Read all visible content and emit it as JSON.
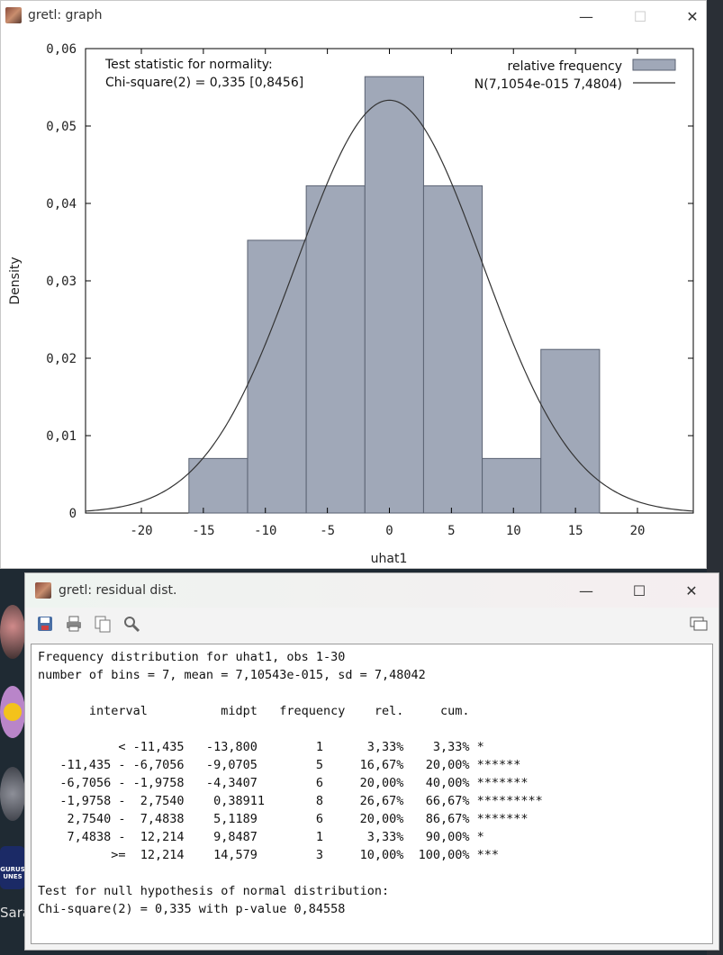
{
  "graph_window": {
    "title": "gretl: graph",
    "controls": {
      "minimize": "—",
      "maximize": "☐",
      "close": "✕"
    }
  },
  "chart_data": {
    "type": "bar",
    "xlabel": "uhat1",
    "ylabel": "Density",
    "xlim": [
      -24.5,
      24.5
    ],
    "ylim": [
      0,
      0.06
    ],
    "x_ticks": [
      "-20",
      "-15",
      "-10",
      "-5",
      "0",
      "5",
      "10",
      "15",
      "20"
    ],
    "y_ticks": [
      "0",
      "0,01",
      "0,02",
      "0,03",
      "0,04",
      "0,05",
      "0,06"
    ],
    "annotation": [
      "Test statistic for normality:",
      "Chi-square(2) = 0,335 [0,8456]"
    ],
    "legend": [
      "relative frequency",
      "N(7,1054e-015 7,4804)"
    ],
    "bin_width": 4.7298,
    "bins": [
      {
        "midpt": -13.8,
        "density": 0.00705
      },
      {
        "midpt": -9.0705,
        "density": 0.03524
      },
      {
        "midpt": -4.3407,
        "density": 0.04228
      },
      {
        "midpt": 0.38911,
        "density": 0.05638
      },
      {
        "midpt": 5.1189,
        "density": 0.04228
      },
      {
        "midpt": 9.8487,
        "density": 0.00705
      },
      {
        "midpt": 14.579,
        "density": 0.02114
      }
    ],
    "normal_curve": {
      "mean": 0,
      "sd": 7.4804
    },
    "colors": {
      "bar_fill": "#a0a8b8",
      "bar_stroke": "#5a6272",
      "curve": "#333333"
    }
  },
  "resid_window": {
    "title": "gretl: residual dist.",
    "controls": {
      "minimize": "—",
      "maximize": "☐",
      "close": "✕"
    },
    "toolbar": [
      "save-icon",
      "print-icon",
      "copy-icon",
      "find-icon",
      "windows-icon"
    ],
    "lines": [
      "Frequency distribution for uhat1, obs 1-30",
      "number of bins = 7, mean = 7,10543e-015, sd = 7,48042",
      "",
      "       interval          midpt   frequency    rel.     cum.",
      "",
      "           < -11,435   -13,800        1      3,33%    3,33% *",
      "   -11,435 - -6,7056   -9,0705        5     16,67%   20,00% ******",
      "   -6,7056 - -1,9758   -4,3407        6     20,00%   40,00% *******",
      "   -1,9758 -  2,7540    0,38911       8     26,67%   66,67% *********",
      "    2,7540 -  7,4838    5,1189        6     20,00%   86,67% *******",
      "    7,4838 -  12,214    9,8487        1      3,33%   90,00% *",
      "          >=  12,214    14,579        3     10,00%  100,00% ***",
      "",
      "Test for null hypothesis of normal distribution:",
      "Chi-square(2) = 0,335 with p-value 0,84558"
    ]
  },
  "desktop": {
    "label": "Sara",
    "badge_lines": [
      "GURUS",
      "UNES"
    ]
  }
}
